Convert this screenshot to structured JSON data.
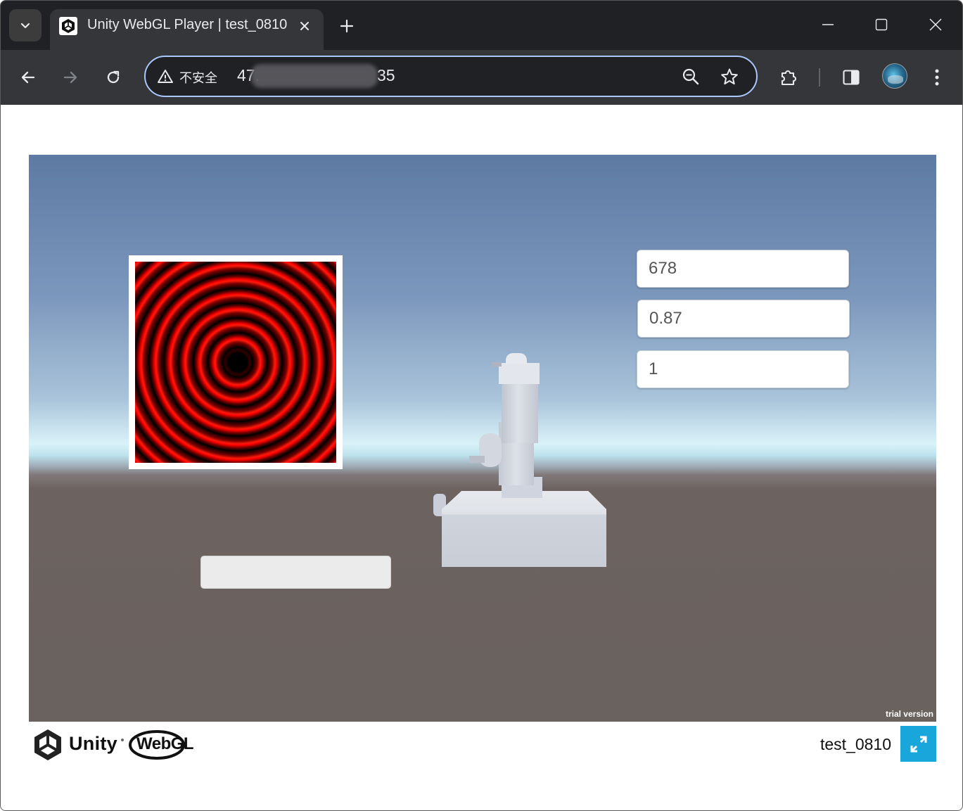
{
  "browser": {
    "tab": {
      "title": "Unity WebGL Player | test_0810",
      "favicon": "unity-icon"
    },
    "address_bar": {
      "security_label": "不安全",
      "url_visible_start": "47.",
      "url_visible_end": "35"
    }
  },
  "unity_canvas": {
    "inputs": [
      {
        "value": "678"
      },
      {
        "value": "0.87"
      },
      {
        "value": "1"
      }
    ],
    "action_button_label": "",
    "trial_label": "trial version",
    "fringe_pattern": {
      "ring_color": "#ff0000",
      "background_color": "#000000"
    }
  },
  "footer": {
    "unity_text": "Unity",
    "webgl_text": "WebGL",
    "build_title": "test_0810",
    "fullscreen_color": "#18a6db"
  },
  "colors": {
    "tab_strip": "#202124",
    "toolbar": "#35363a",
    "omnibox_focus": "#a8c7fa"
  }
}
